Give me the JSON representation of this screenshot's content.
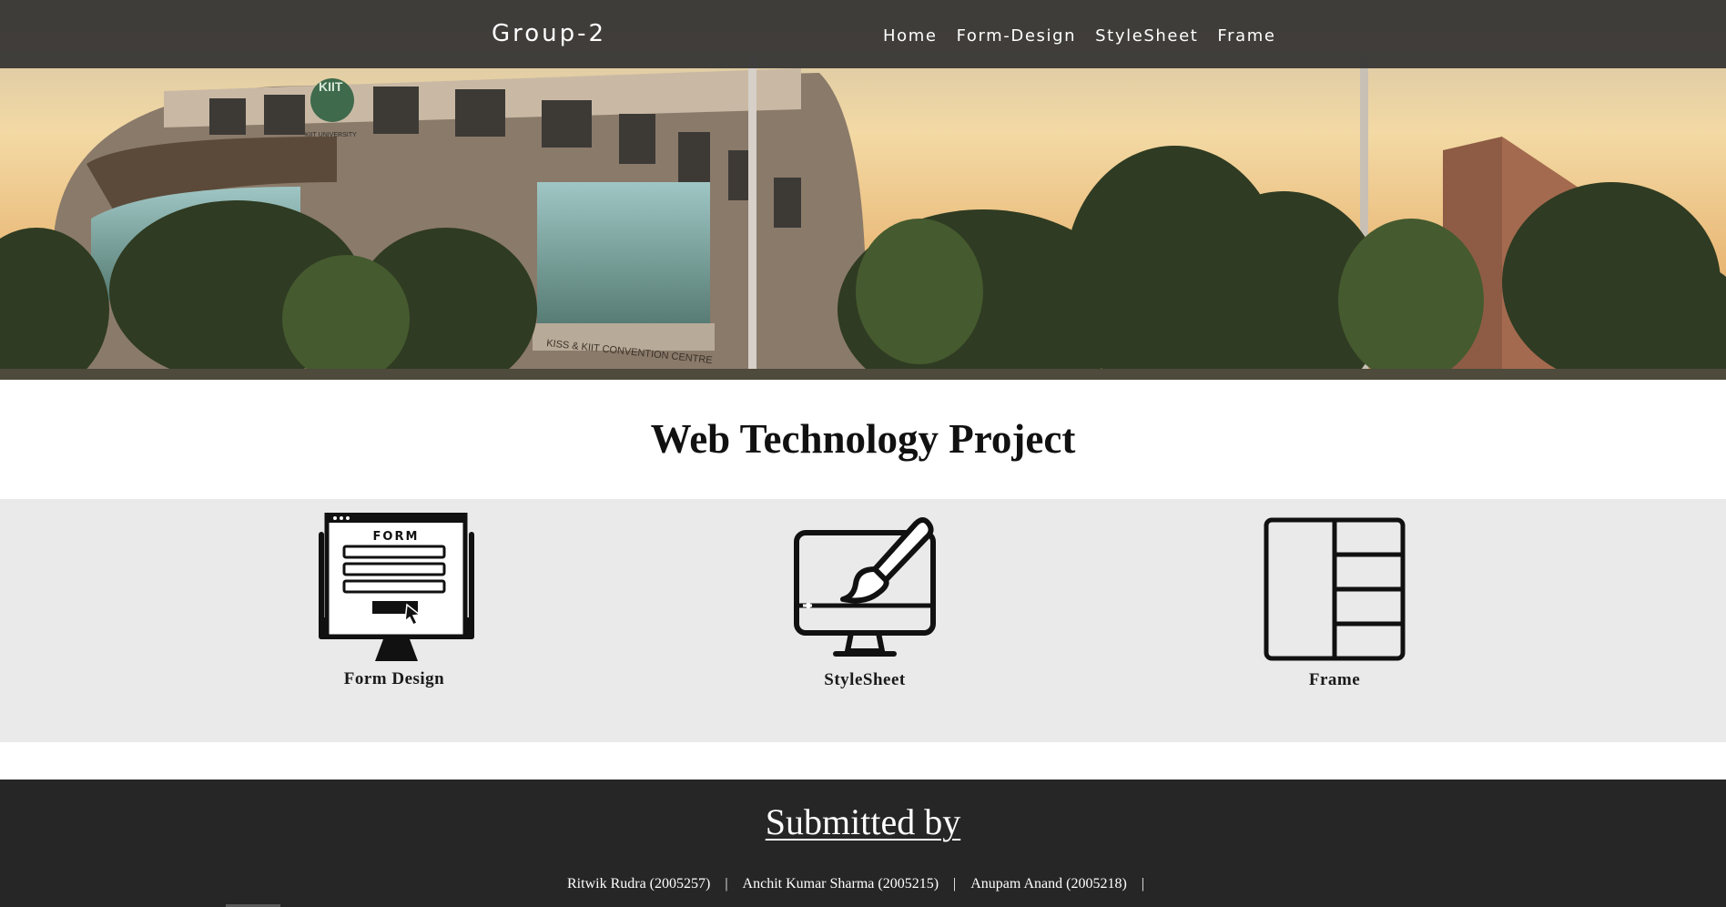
{
  "navbar": {
    "brand": "Group-2",
    "links": [
      {
        "label": "Home"
      },
      {
        "label": "Form-Design"
      },
      {
        "label": "StyleSheet"
      },
      {
        "label": "Frame"
      }
    ]
  },
  "hero": {
    "sign_text": "KISS & KIIT CONVENTION CENTRE",
    "logo_text": "KIIT",
    "logo_subtext": "KIIT UNIVERSITY"
  },
  "main": {
    "title": "Web Technology Project",
    "cards": [
      {
        "label": "Form Design",
        "icon": "form-design-icon",
        "icon_text": "FORM"
      },
      {
        "label": "StyleSheet",
        "icon": "stylesheet-icon"
      },
      {
        "label": "Frame",
        "icon": "frame-icon"
      }
    ]
  },
  "footer": {
    "heading": "Submitted by",
    "members": [
      {
        "name": "Ritwik Rudra (2005257)"
      },
      {
        "name": "Anchit Kumar Sharma (2005215)"
      },
      {
        "name": "Anupam Anand (2005218)"
      }
    ],
    "separator": "|"
  },
  "colors": {
    "navbar_bg": "#343331",
    "band_bg": "#eaeaea",
    "footer_bg": "#262626",
    "text_dark": "#111111",
    "text_light": "#ffffff"
  }
}
